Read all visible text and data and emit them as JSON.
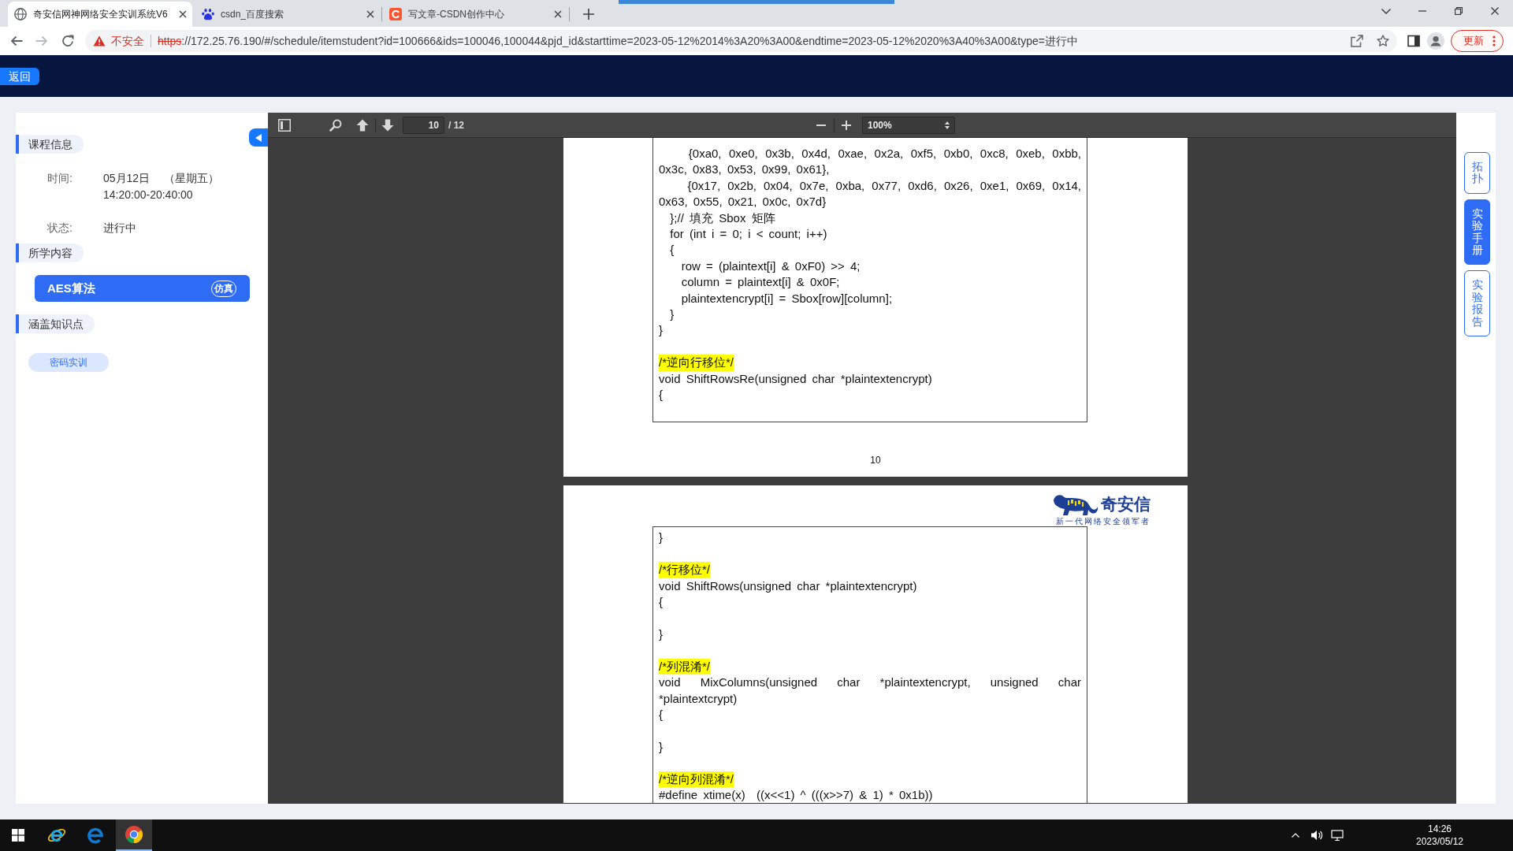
{
  "browser": {
    "tabs": [
      {
        "title": "奇安信网神网络安全实训系统V6",
        "selected": true
      },
      {
        "title": "csdn_百度搜索",
        "selected": false
      },
      {
        "title": "写文章-CSDN创作中心",
        "selected": false
      }
    ],
    "forward_disabled": true,
    "address": {
      "security_label": "不安全",
      "scheme": "https",
      "rest": "://172.25.76.190/#/schedule/itemstudent?id=100666&ids=100046,100044&pjd_id&starttime=2023-05-12%2014%3A20%3A00&endtime=2023-05-12%2020%3A40%3A00&type=进行中"
    },
    "update_button": "更新"
  },
  "app": {
    "back_button": "返回",
    "sidebar": {
      "course_info": {
        "heading": "课程信息",
        "time_label": "时间:",
        "date": "05月12日",
        "weekday": "（星期五）",
        "time_range": "14:20:00-20:40:00",
        "status_label": "状态:",
        "status": "进行中"
      },
      "content": {
        "heading": "所学内容",
        "items": [
          {
            "title": "AES算法",
            "badge": "仿真",
            "selected": true
          }
        ]
      },
      "knowledge": {
        "heading": "涵盖知识点",
        "tags": [
          "密码实训"
        ]
      }
    },
    "viewer": {
      "page_input": "10",
      "page_count": "/ 12",
      "zoom": "100%",
      "pages": [
        {
          "page_number": "10",
          "blocks": [
            {
              "lines": [
                {
                  "kind": "code",
                  "text": "    {0xa0, 0xe0, 0x3b, 0x4d, 0xae, 0x2a, 0xf5, 0xb0, 0xc8, 0xeb, 0xbb, 0x3c, 0x83, 0x53, 0x99, 0x61},"
                },
                {
                  "kind": "code",
                  "text": "    {0x17, 0x2b, 0x04, 0x7e, 0xba, 0x77, 0xd6, 0x26, 0xe1, 0x69, 0x14, 0x63, 0x55, 0x21, 0x0c, 0x7d}"
                },
                {
                  "kind": "code",
                  "text": "  };// 填充 Sbox 矩阵"
                },
                {
                  "kind": "code",
                  "text": "  for (int i = 0; i < count; i++)"
                },
                {
                  "kind": "code",
                  "text": "  {"
                },
                {
                  "kind": "code",
                  "text": "    row = (plaintext[i] & 0xF0) >> 4;"
                },
                {
                  "kind": "code",
                  "text": "    column = plaintext[i] & 0x0F;"
                },
                {
                  "kind": "code",
                  "text": "    plaintextencrypt[i] = Sbox[row][column];"
                },
                {
                  "kind": "code",
                  "text": "  }"
                },
                {
                  "kind": "code",
                  "text": "}"
                }
              ]
            },
            {
              "lines": [
                {
                  "kind": "comment",
                  "text": "/*逆向行移位*/"
                },
                {
                  "kind": "code",
                  "text": "void ShiftRowsRe(unsigned char *plaintextencrypt)"
                },
                {
                  "kind": "code",
                  "text": "{"
                }
              ]
            }
          ]
        },
        {
          "logo_name": "奇安信",
          "logo_tagline": "新一代网络安全领军者",
          "blocks": [
            {
              "lines": [
                {
                  "kind": "code",
                  "text": "}"
                }
              ]
            },
            {
              "lines": [
                {
                  "kind": "comment",
                  "text": "/*行移位*/"
                },
                {
                  "kind": "code",
                  "text": "void ShiftRows(unsigned char *plaintextencrypt)"
                },
                {
                  "kind": "code",
                  "text": "{"
                }
              ]
            },
            {
              "lines": [
                {
                  "kind": "code",
                  "text": "}"
                }
              ]
            },
            {
              "lines": [
                {
                  "kind": "comment",
                  "text": "/*列混淆*/"
                },
                {
                  "kind": "code",
                  "text": "void MixColumns(unsigned char *plaintextencrypt, unsigned char *plaintextcrypt)"
                },
                {
                  "kind": "code",
                  "text": "{"
                }
              ]
            },
            {
              "lines": [
                {
                  "kind": "code",
                  "text": "}"
                }
              ]
            },
            {
              "lines": [
                {
                  "kind": "comment",
                  "text": "/*逆向列混淆*/"
                },
                {
                  "kind": "code",
                  "text": "#define xtime(x)  ((x<<1) ^ (((x>>7) & 1) * 0x1b))"
                }
              ]
            }
          ]
        }
      ]
    },
    "side_tabs": [
      {
        "label": "拓扑",
        "selected": false
      },
      {
        "label": "实验手册",
        "selected": true
      },
      {
        "label": "实验报告",
        "selected": false
      }
    ]
  },
  "taskbar": {
    "apps": [
      {
        "selected": false
      },
      {
        "selected": false
      },
      {
        "selected": true
      }
    ],
    "time": "14:26",
    "date": "2023/05/12"
  }
}
